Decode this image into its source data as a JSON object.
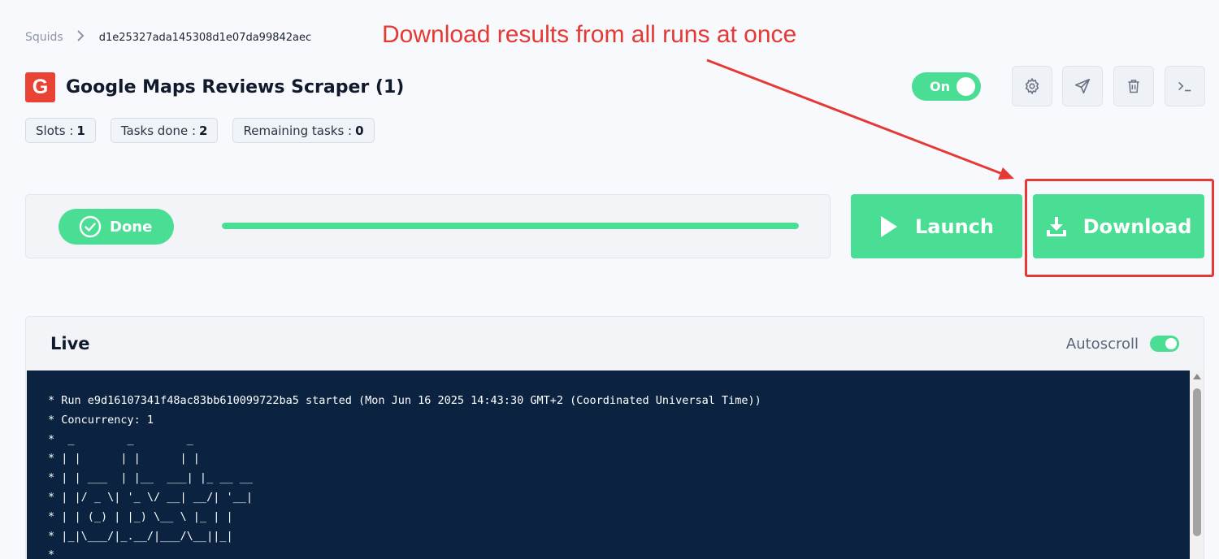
{
  "breadcrumb": {
    "root": "Squids",
    "current": "d1e25327ada145308d1e07da99842aec"
  },
  "header": {
    "logo_letter": "G",
    "title": "Google Maps Reviews Scraper (1)",
    "toggle_label": "On"
  },
  "stats": [
    {
      "label": "Slots :",
      "value": "1"
    },
    {
      "label": "Tasks done :",
      "value": "2"
    },
    {
      "label": "Remaining tasks :",
      "value": "0"
    }
  ],
  "toolbar": {
    "icons": [
      "gear-icon",
      "send-icon",
      "trash-icon",
      "terminal-icon"
    ]
  },
  "annotation": {
    "text": "Download results from all runs at once",
    "color": "#e53935"
  },
  "status": {
    "label": "Done",
    "progress": 1.0
  },
  "actions": {
    "launch_label": "Launch",
    "download_label": "Download"
  },
  "live": {
    "title": "Live",
    "autoscroll_label": "Autoscroll",
    "log": "* Run e9d16107341f48ac83bb610099722ba5 started (Mon Jun 16 2025 14:43:30 GMT+2 (Coordinated Universal Time))\n* Concurrency: 1\n*  _        _        _\n* | |      | |      | |\n* | | ___  | |__  ___| |_ __ __\n* | |/ _ \\| '_ \\/ __| __/| '__|\n* | | (_) | |_) \\__ \\ |_ | |\n* |_|\\___/|_.__/|___/\\__||_|\n*"
  },
  "colors": {
    "accent": "#4ade94",
    "logo": "#e94335",
    "terminal_bg": "#0b2340"
  }
}
